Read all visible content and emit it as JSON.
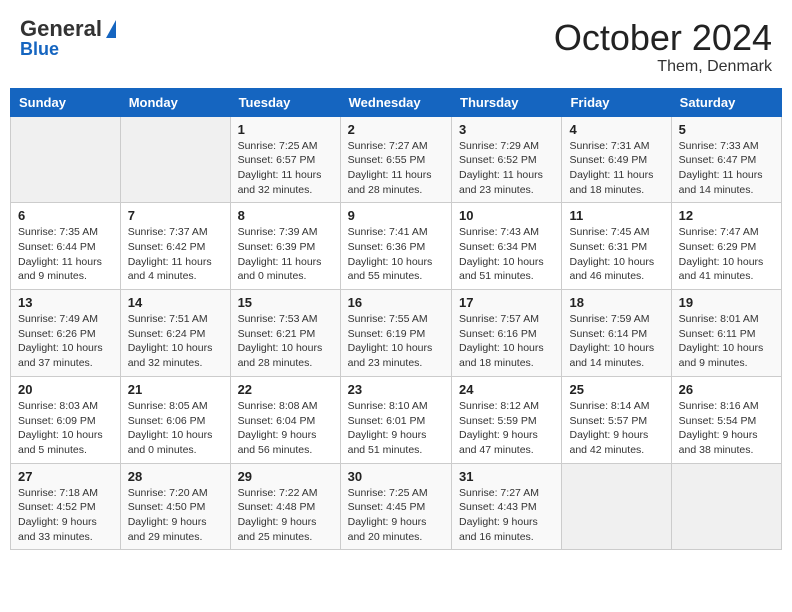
{
  "header": {
    "logo_general": "General",
    "logo_blue": "Blue",
    "month": "October 2024",
    "location": "Them, Denmark"
  },
  "weekdays": [
    "Sunday",
    "Monday",
    "Tuesday",
    "Wednesday",
    "Thursday",
    "Friday",
    "Saturday"
  ],
  "weeks": [
    [
      {
        "day": "",
        "sunrise": "",
        "sunset": "",
        "daylight": ""
      },
      {
        "day": "",
        "sunrise": "",
        "sunset": "",
        "daylight": ""
      },
      {
        "day": "1",
        "sunrise": "Sunrise: 7:25 AM",
        "sunset": "Sunset: 6:57 PM",
        "daylight": "Daylight: 11 hours and 32 minutes."
      },
      {
        "day": "2",
        "sunrise": "Sunrise: 7:27 AM",
        "sunset": "Sunset: 6:55 PM",
        "daylight": "Daylight: 11 hours and 28 minutes."
      },
      {
        "day": "3",
        "sunrise": "Sunrise: 7:29 AM",
        "sunset": "Sunset: 6:52 PM",
        "daylight": "Daylight: 11 hours and 23 minutes."
      },
      {
        "day": "4",
        "sunrise": "Sunrise: 7:31 AM",
        "sunset": "Sunset: 6:49 PM",
        "daylight": "Daylight: 11 hours and 18 minutes."
      },
      {
        "day": "5",
        "sunrise": "Sunrise: 7:33 AM",
        "sunset": "Sunset: 6:47 PM",
        "daylight": "Daylight: 11 hours and 14 minutes."
      }
    ],
    [
      {
        "day": "6",
        "sunrise": "Sunrise: 7:35 AM",
        "sunset": "Sunset: 6:44 PM",
        "daylight": "Daylight: 11 hours and 9 minutes."
      },
      {
        "day": "7",
        "sunrise": "Sunrise: 7:37 AM",
        "sunset": "Sunset: 6:42 PM",
        "daylight": "Daylight: 11 hours and 4 minutes."
      },
      {
        "day": "8",
        "sunrise": "Sunrise: 7:39 AM",
        "sunset": "Sunset: 6:39 PM",
        "daylight": "Daylight: 11 hours and 0 minutes."
      },
      {
        "day": "9",
        "sunrise": "Sunrise: 7:41 AM",
        "sunset": "Sunset: 6:36 PM",
        "daylight": "Daylight: 10 hours and 55 minutes."
      },
      {
        "day": "10",
        "sunrise": "Sunrise: 7:43 AM",
        "sunset": "Sunset: 6:34 PM",
        "daylight": "Daylight: 10 hours and 51 minutes."
      },
      {
        "day": "11",
        "sunrise": "Sunrise: 7:45 AM",
        "sunset": "Sunset: 6:31 PM",
        "daylight": "Daylight: 10 hours and 46 minutes."
      },
      {
        "day": "12",
        "sunrise": "Sunrise: 7:47 AM",
        "sunset": "Sunset: 6:29 PM",
        "daylight": "Daylight: 10 hours and 41 minutes."
      }
    ],
    [
      {
        "day": "13",
        "sunrise": "Sunrise: 7:49 AM",
        "sunset": "Sunset: 6:26 PM",
        "daylight": "Daylight: 10 hours and 37 minutes."
      },
      {
        "day": "14",
        "sunrise": "Sunrise: 7:51 AM",
        "sunset": "Sunset: 6:24 PM",
        "daylight": "Daylight: 10 hours and 32 minutes."
      },
      {
        "day": "15",
        "sunrise": "Sunrise: 7:53 AM",
        "sunset": "Sunset: 6:21 PM",
        "daylight": "Daylight: 10 hours and 28 minutes."
      },
      {
        "day": "16",
        "sunrise": "Sunrise: 7:55 AM",
        "sunset": "Sunset: 6:19 PM",
        "daylight": "Daylight: 10 hours and 23 minutes."
      },
      {
        "day": "17",
        "sunrise": "Sunrise: 7:57 AM",
        "sunset": "Sunset: 6:16 PM",
        "daylight": "Daylight: 10 hours and 18 minutes."
      },
      {
        "day": "18",
        "sunrise": "Sunrise: 7:59 AM",
        "sunset": "Sunset: 6:14 PM",
        "daylight": "Daylight: 10 hours and 14 minutes."
      },
      {
        "day": "19",
        "sunrise": "Sunrise: 8:01 AM",
        "sunset": "Sunset: 6:11 PM",
        "daylight": "Daylight: 10 hours and 9 minutes."
      }
    ],
    [
      {
        "day": "20",
        "sunrise": "Sunrise: 8:03 AM",
        "sunset": "Sunset: 6:09 PM",
        "daylight": "Daylight: 10 hours and 5 minutes."
      },
      {
        "day": "21",
        "sunrise": "Sunrise: 8:05 AM",
        "sunset": "Sunset: 6:06 PM",
        "daylight": "Daylight: 10 hours and 0 minutes."
      },
      {
        "day": "22",
        "sunrise": "Sunrise: 8:08 AM",
        "sunset": "Sunset: 6:04 PM",
        "daylight": "Daylight: 9 hours and 56 minutes."
      },
      {
        "day": "23",
        "sunrise": "Sunrise: 8:10 AM",
        "sunset": "Sunset: 6:01 PM",
        "daylight": "Daylight: 9 hours and 51 minutes."
      },
      {
        "day": "24",
        "sunrise": "Sunrise: 8:12 AM",
        "sunset": "Sunset: 5:59 PM",
        "daylight": "Daylight: 9 hours and 47 minutes."
      },
      {
        "day": "25",
        "sunrise": "Sunrise: 8:14 AM",
        "sunset": "Sunset: 5:57 PM",
        "daylight": "Daylight: 9 hours and 42 minutes."
      },
      {
        "day": "26",
        "sunrise": "Sunrise: 8:16 AM",
        "sunset": "Sunset: 5:54 PM",
        "daylight": "Daylight: 9 hours and 38 minutes."
      }
    ],
    [
      {
        "day": "27",
        "sunrise": "Sunrise: 7:18 AM",
        "sunset": "Sunset: 4:52 PM",
        "daylight": "Daylight: 9 hours and 33 minutes."
      },
      {
        "day": "28",
        "sunrise": "Sunrise: 7:20 AM",
        "sunset": "Sunset: 4:50 PM",
        "daylight": "Daylight: 9 hours and 29 minutes."
      },
      {
        "day": "29",
        "sunrise": "Sunrise: 7:22 AM",
        "sunset": "Sunset: 4:48 PM",
        "daylight": "Daylight: 9 hours and 25 minutes."
      },
      {
        "day": "30",
        "sunrise": "Sunrise: 7:25 AM",
        "sunset": "Sunset: 4:45 PM",
        "daylight": "Daylight: 9 hours and 20 minutes."
      },
      {
        "day": "31",
        "sunrise": "Sunrise: 7:27 AM",
        "sunset": "Sunset: 4:43 PM",
        "daylight": "Daylight: 9 hours and 16 minutes."
      },
      {
        "day": "",
        "sunrise": "",
        "sunset": "",
        "daylight": ""
      },
      {
        "day": "",
        "sunrise": "",
        "sunset": "",
        "daylight": ""
      }
    ]
  ]
}
